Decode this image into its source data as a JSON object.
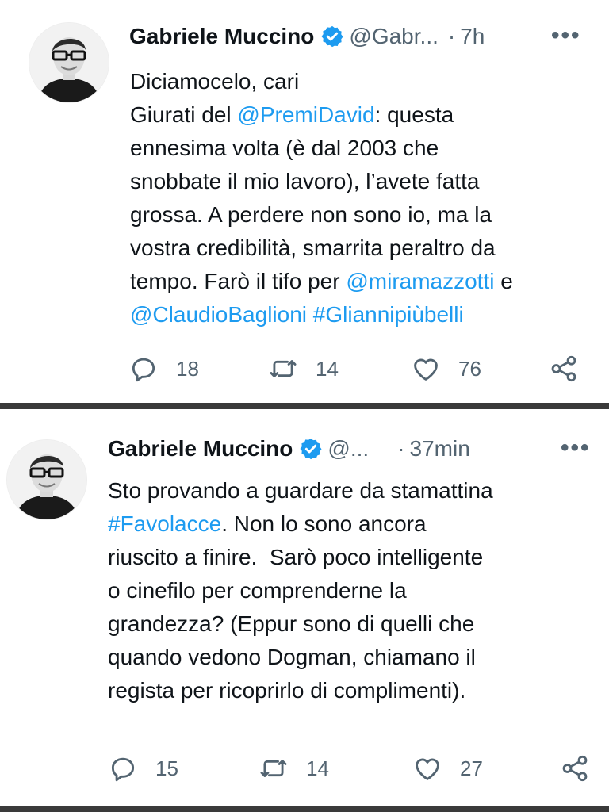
{
  "tweets": [
    {
      "display_name": "Gabriele Muccino",
      "handle": "@Gabr...",
      "separator": "·",
      "time": "7h",
      "more": "•••",
      "body": [
        {
          "text": "Diciamocelo, cari\nGiurati del "
        },
        {
          "text": "@PremiDavid",
          "link": true
        },
        {
          "text": ": questa\nennesima volta (è dal 2003 che\nsnobbate il mio lavoro), l’avete fatta\ngrossa. A perdere non sono io, ma la\nvostra credibilità, smarrita peraltro da\ntempo. Farò il tifo per "
        },
        {
          "text": "@miramazzotti",
          "link": true
        },
        {
          "text": " e\n"
        },
        {
          "text": "@ClaudioBaglioni",
          "link": true
        },
        {
          "text": " "
        },
        {
          "text": "#Gliannipiùbelli",
          "link": true
        }
      ],
      "replies": "18",
      "retweets": "14",
      "likes": "76"
    },
    {
      "display_name": "Gabriele Muccino",
      "handle": "@...",
      "separator": "·",
      "time": "37min",
      "more": "•••",
      "body": [
        {
          "text": "Sto provando a guardare da stamattina\n"
        },
        {
          "text": "#Favolacce",
          "link": true
        },
        {
          "text": ". Non lo sono ancora\nriuscito a finire.  Sarò poco intelligente\no cinefilo per comprenderne la\ngrandezza? (Eppur sono di quelli che\nquando vedono Dogman, chiamano il\nregista per ricoprirlo di complimenti)."
        }
      ],
      "replies": "15",
      "retweets": "14",
      "likes": "27"
    }
  ],
  "icons": {
    "verified": "verified-badge-icon",
    "reply": "reply-icon",
    "retweet": "retweet-icon",
    "like": "heart-icon",
    "share": "share-icon"
  },
  "colors": {
    "link": "#1d9bf0",
    "verified": "#1d9bf0",
    "muted": "#536471",
    "text": "#0f1419",
    "separator": "#3a3a3a"
  }
}
